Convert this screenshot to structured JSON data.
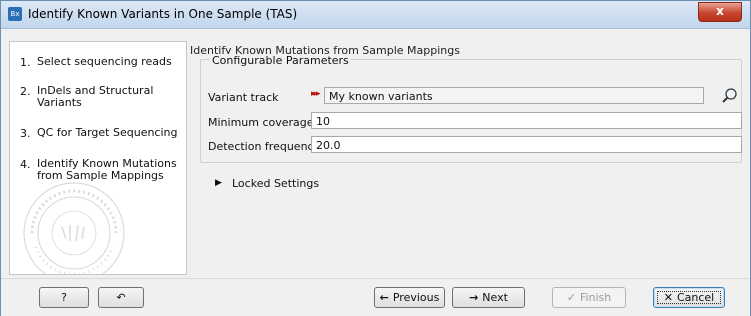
{
  "window": {
    "app_icon_text": "Bx",
    "title": "Identify Known Variants in One Sample (TAS)",
    "close_label": "x"
  },
  "steps": [
    {
      "num": "1.",
      "label": "Select sequencing reads"
    },
    {
      "num": "2.",
      "label": "InDels and Structural Variants"
    },
    {
      "num": "3.",
      "label": "QC for Target Sequencing"
    },
    {
      "num": "4.",
      "label": "Identify Known Mutations from Sample Mappings"
    }
  ],
  "main": {
    "section_title": "Identify Known Mutations from Sample Mappings",
    "group_title": "Configurable Parameters",
    "variant_track_label": "Variant track",
    "variant_track_value": "My known variants",
    "min_coverage_label": "Minimum coverage",
    "min_coverage_value": "10",
    "detection_freq_label": "Detection frequency",
    "detection_freq_value": "20.0",
    "locked_settings_label": "Locked Settings"
  },
  "buttons": {
    "help": "?",
    "reset_icon": "↶",
    "previous": "Previous",
    "next": "Next",
    "finish": "Finish",
    "cancel": "Cancel"
  }
}
